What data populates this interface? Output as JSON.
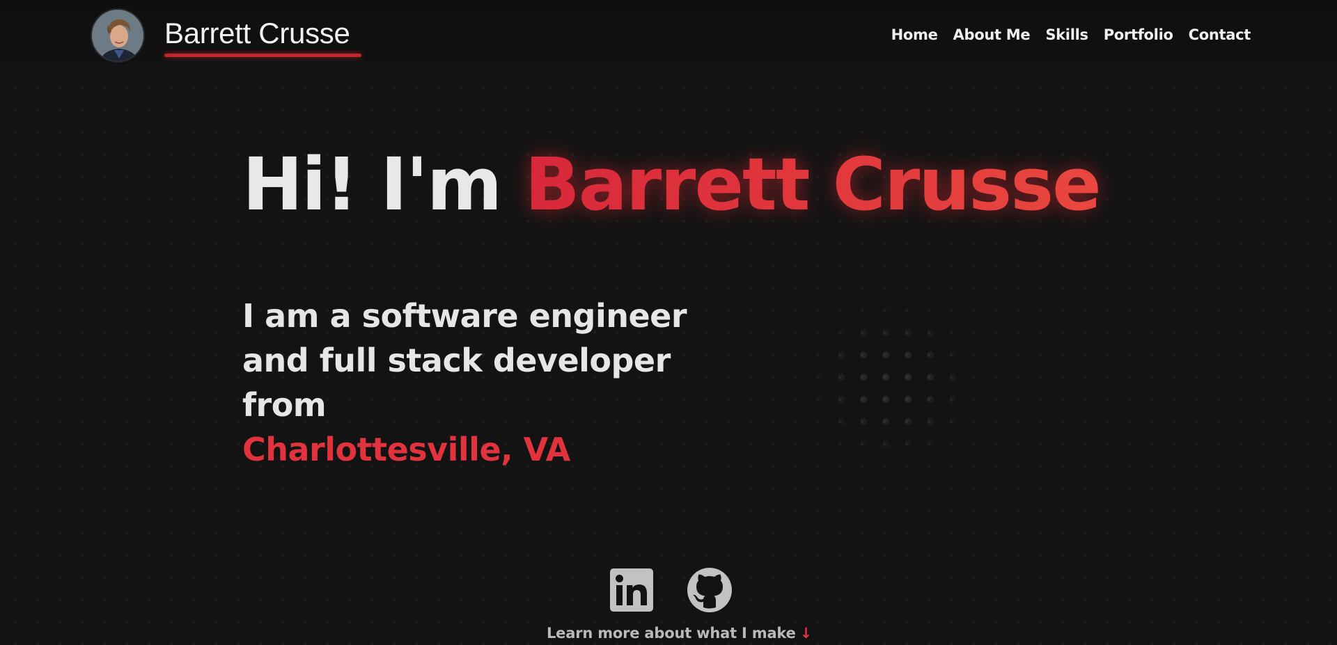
{
  "header": {
    "brand": "Barrett Crusse",
    "nav": [
      "Home",
      "About Me",
      "Skills",
      "Portfolio",
      "Contact"
    ]
  },
  "hero": {
    "greeting": "Hi! I'm ",
    "name": "Barrett Crusse",
    "tagline": "I am a software engineer and full stack developer from",
    "location": "Charlottesville, VA"
  },
  "socials": {
    "linkedin_icon": "linkedin-icon",
    "github_icon": "github-icon"
  },
  "cta": {
    "label": "Learn more about what I make",
    "arrow": "↓"
  },
  "colors": {
    "background": "#131313",
    "accent": "#e0333d",
    "text": "#e6e6e6"
  }
}
